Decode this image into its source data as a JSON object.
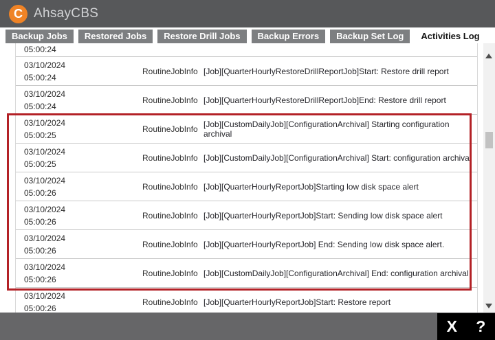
{
  "header": {
    "logo_letter": "C",
    "app_name": "AhsayCBS"
  },
  "tabs": [
    {
      "label": "Backup Jobs",
      "active": false
    },
    {
      "label": "Restored Jobs",
      "active": false
    },
    {
      "label": "Restore Drill Jobs",
      "active": false
    },
    {
      "label": "Backup Errors",
      "active": false
    },
    {
      "label": "Backup Set Log",
      "active": false
    },
    {
      "label": "Activities Log",
      "active": true
    }
  ],
  "log": {
    "partial_top_row": {
      "time": "05:00:24"
    },
    "rows": [
      {
        "date": "03/10/2024",
        "time": "05:00:24",
        "type": "RoutineJobInfo",
        "message": "[Job][QuarterHourlyRestoreDrillReportJob]Start: Restore drill report",
        "highlighted": false
      },
      {
        "date": "03/10/2024",
        "time": "05:00:24",
        "type": "RoutineJobInfo",
        "message": "[Job][QuarterHourlyRestoreDrillReportJob]End: Restore drill report",
        "highlighted": false
      },
      {
        "date": "03/10/2024",
        "time": "05:00:25",
        "type": "RoutineJobInfo",
        "message": "[Job][CustomDailyJob][ConfigurationArchival] Starting configuration archival",
        "highlighted": true
      },
      {
        "date": "03/10/2024",
        "time": "05:00:25",
        "type": "RoutineJobInfo",
        "message": "[Job][CustomDailyJob][ConfigurationArchival] Start: configuration archival",
        "highlighted": true
      },
      {
        "date": "03/10/2024",
        "time": "05:00:26",
        "type": "RoutineJobInfo",
        "message": "[Job][QuarterHourlyReportJob]Starting low disk space alert",
        "highlighted": true
      },
      {
        "date": "03/10/2024",
        "time": "05:00:26",
        "type": "RoutineJobInfo",
        "message": "[Job][QuarterHourlyReportJob]Start: Sending low disk space alert",
        "highlighted": true
      },
      {
        "date": "03/10/2024",
        "time": "05:00:26",
        "type": "RoutineJobInfo",
        "message": "[Job][QuarterHourlyReportJob] End: Sending low disk space alert.",
        "highlighted": true
      },
      {
        "date": "03/10/2024",
        "time": "05:00:26",
        "type": "RoutineJobInfo",
        "message": "[Job][CustomDailyJob][ConfigurationArchival] End: configuration archival",
        "highlighted": true
      },
      {
        "date": "03/10/2024",
        "time": "05:00:26",
        "type": "RoutineJobInfo",
        "message": "[Job][QuarterHourlyReportJob]Start: Restore report",
        "highlighted": false
      }
    ]
  },
  "footer": {
    "close_label": "X",
    "help_label": "?"
  },
  "colors": {
    "header_bg": "#57585a",
    "logo_orange": "#ef8326",
    "tab_gray": "#7d7f81",
    "highlight_red": "#b32126",
    "footer_gray": "#666668"
  }
}
